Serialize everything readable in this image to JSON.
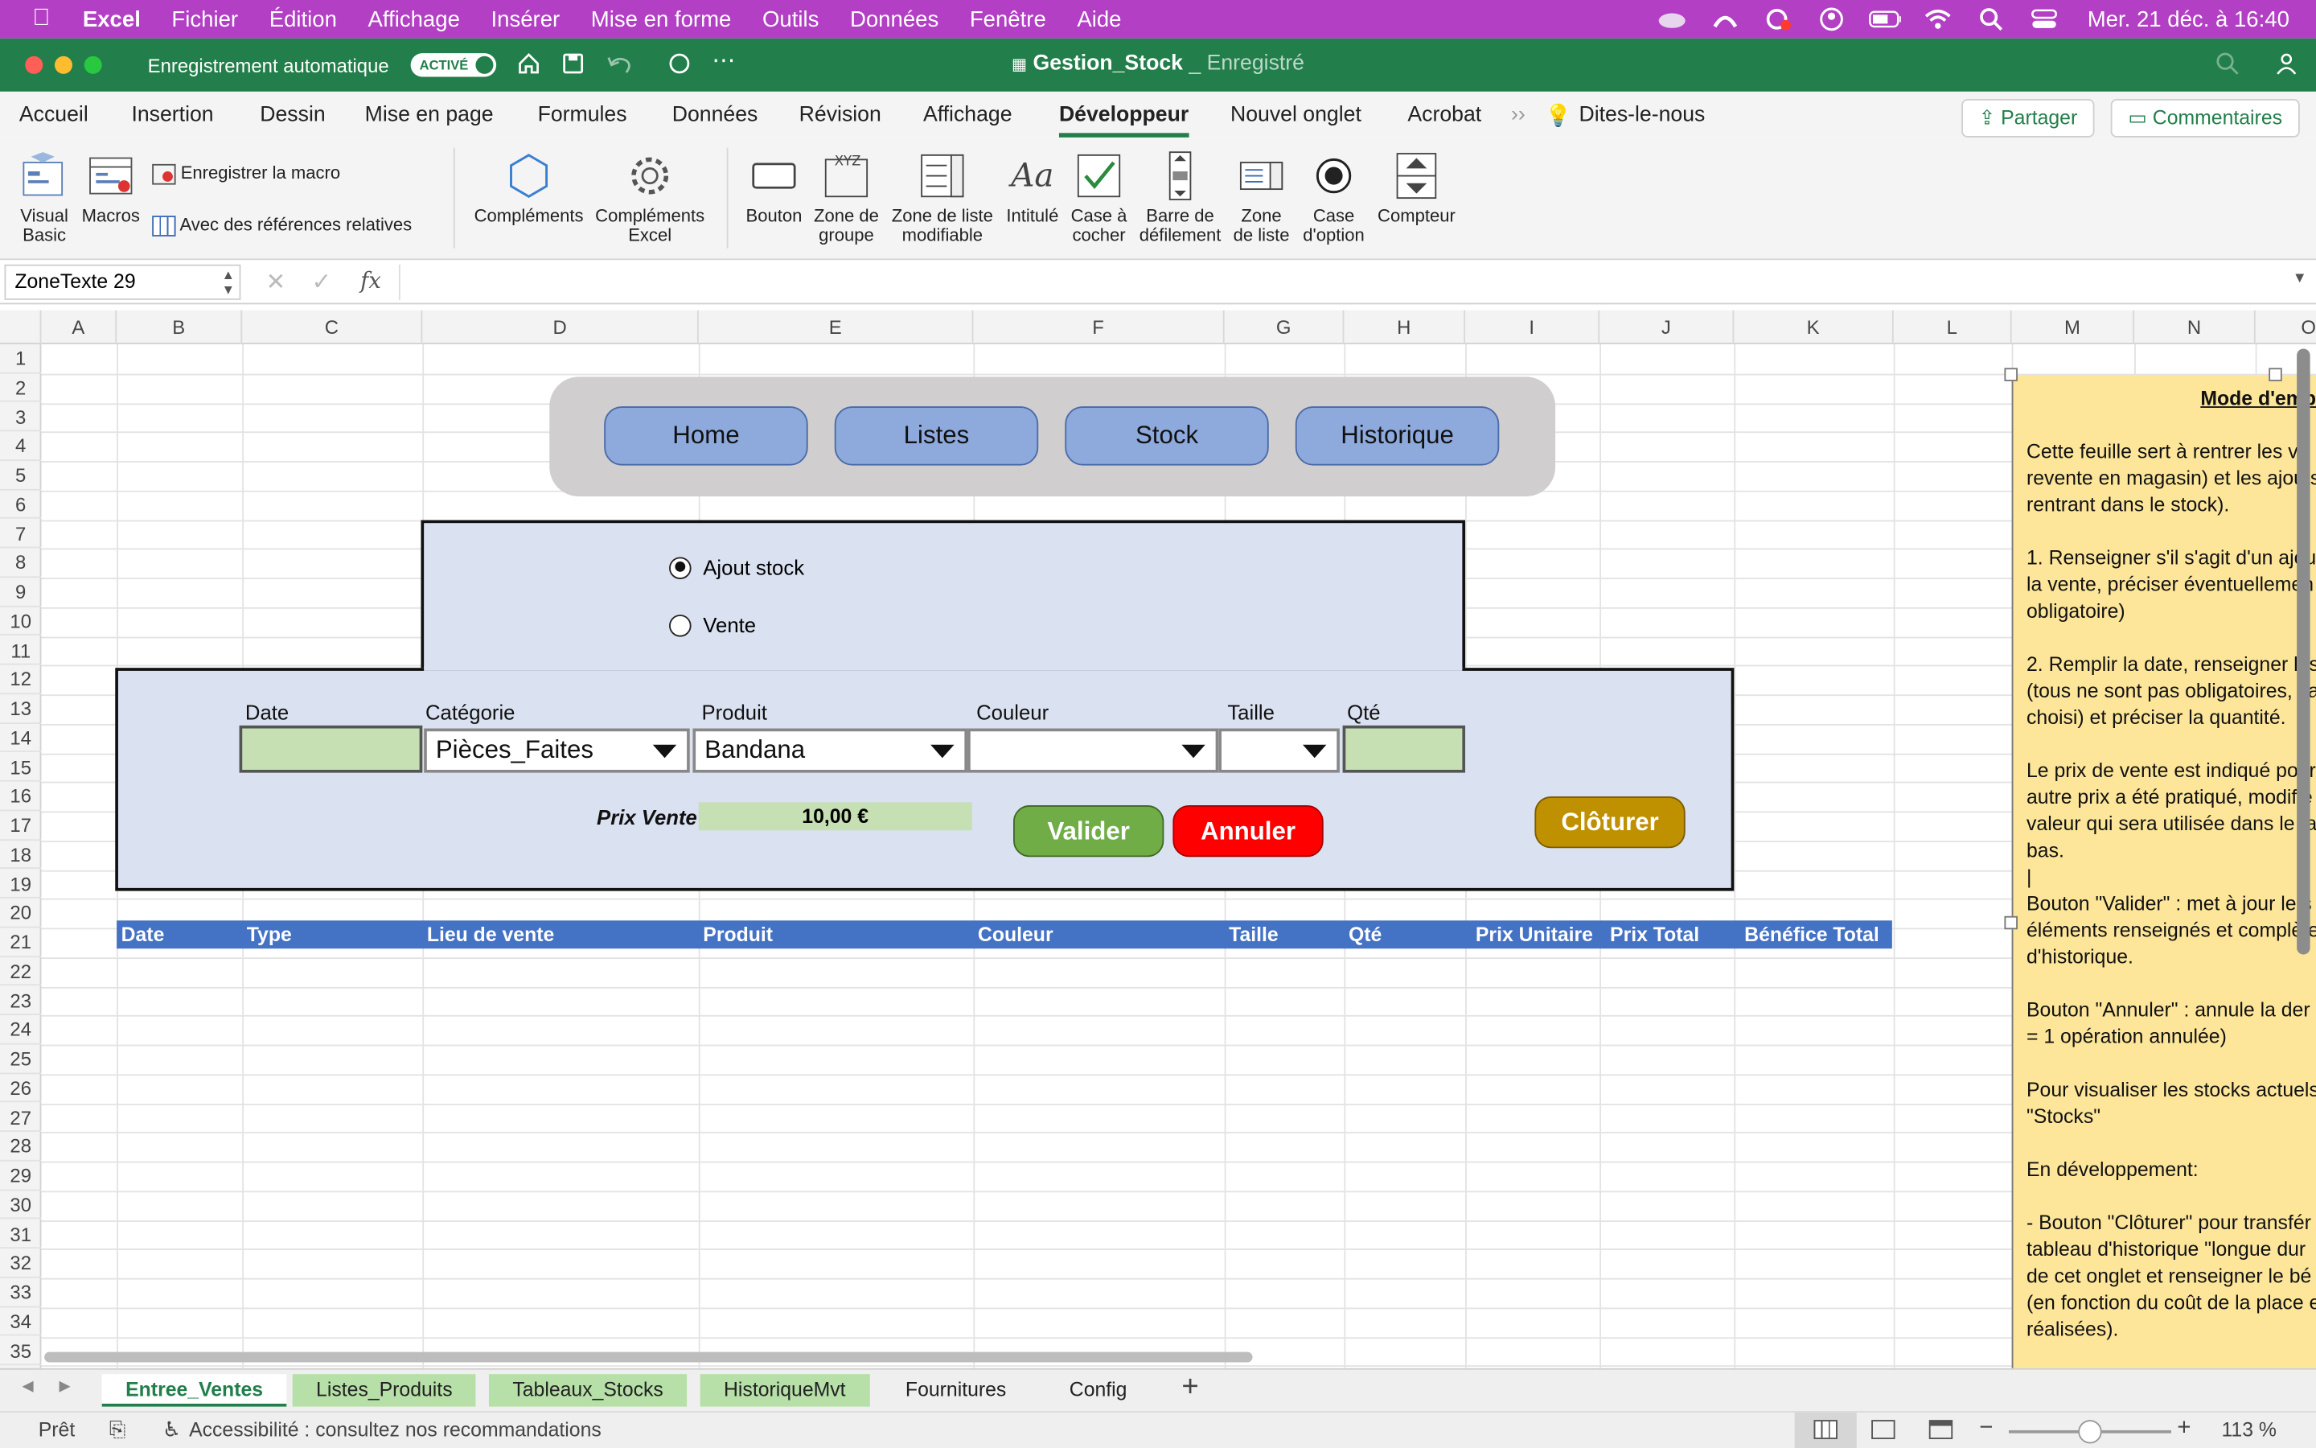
{
  "menubar": {
    "app": "Excel",
    "items": [
      "Fichier",
      "Édition",
      "Affichage",
      "Insérer",
      "Mise en forme",
      "Outils",
      "Données",
      "Fenêtre",
      "Aide"
    ],
    "datetime": "Mer. 21 déc. à 16:40"
  },
  "titlebar": {
    "autosave_label": "Enregistrement automatique",
    "autosave_state": "ACTIVÉ",
    "filename": "Gestion_Stock",
    "saved_status": "_ Enregistré"
  },
  "ribbon_tabs": [
    "Accueil",
    "Insertion",
    "Dessin",
    "Mise en page",
    "Formules",
    "Données",
    "Révision",
    "Affichage",
    "Développeur",
    "Nouvel onglet",
    "Acrobat"
  ],
  "ribbon_tabs_active": "Développeur",
  "tell_me": "Dites-le-nous",
  "share_label": "Partager",
  "comments_label": "Commentaires",
  "ribbon": {
    "visual_basic": "Visual Basic",
    "macros": "Macros",
    "record_macro": "Enregistrer la macro",
    "relative_refs": "Avec des références relatives",
    "addins": "Compléments",
    "excel_addins": "Compléments Excel",
    "button": "Bouton",
    "group_box": "Zone de groupe",
    "combo_box": "Zone de liste modifiable",
    "label": "Intitulé",
    "checkbox": "Case à cocher",
    "scrollbar": "Barre de défilement",
    "list_box": "Zone de liste",
    "option_button": "Case d'option",
    "spinner": "Compteur"
  },
  "formula_bar": {
    "name_box": "ZoneTexte 29",
    "fx": "fx",
    "value": ""
  },
  "columns": [
    "A",
    "B",
    "C",
    "D",
    "E",
    "F",
    "G",
    "H",
    "I",
    "J",
    "K",
    "L",
    "M",
    "N",
    "O"
  ],
  "rows": [
    "1",
    "2",
    "3",
    "4",
    "5",
    "6",
    "7",
    "8",
    "9",
    "10",
    "11",
    "12",
    "13",
    "14",
    "15",
    "16",
    "17",
    "18",
    "19",
    "20",
    "21",
    "22",
    "23",
    "24",
    "25",
    "26",
    "27",
    "28",
    "29",
    "30",
    "31",
    "32",
    "33",
    "34",
    "35"
  ],
  "nav_buttons": [
    "Home",
    "Listes",
    "Stock",
    "Historique"
  ],
  "mode_options": [
    {
      "label": "Ajout stock",
      "selected": true
    },
    {
      "label": "Vente",
      "selected": false
    }
  ],
  "form": {
    "labels": {
      "date": "Date",
      "category": "Catégorie",
      "product": "Produit",
      "color": "Couleur",
      "size": "Taille",
      "qty": "Qté"
    },
    "values": {
      "date": "",
      "category": "Pièces_Faites",
      "product": "Bandana",
      "color": "",
      "size": "",
      "qty": ""
    },
    "price_label": "Prix Vente",
    "price_value": "10,00 €",
    "validate": "Valider",
    "cancel": "Annuler",
    "close": "Clôturer"
  },
  "table_headers": [
    "Date",
    "Type",
    "Lieu de vente",
    "Produit",
    "Couleur",
    "Taille",
    "Qté",
    "Prix Unitaire",
    "Prix Total",
    "Bénéfice Total"
  ],
  "note": {
    "title": "Mode d'emp",
    "lines": [
      "",
      "Cette feuille sert à rentrer les ve",
      "revente en magasin) et les ajouts",
      "rentrant dans le stock).",
      "",
      "1. Renseigner s'il s'agit d'un ajou",
      "la vente, préciser éventuellemen",
      "obligatoire)",
      "",
      "2. Remplir la date, renseigner les",
      "(tous ne sont pas obligatoires, ça",
      "choisi) et préciser la quantité.",
      "",
      "Le prix de vente est indiqué pour",
      "autre prix a été pratiqué, modifie",
      "valeur qui sera utilisée dans le ta",
      "bas.",
      "|",
      "Bouton \"Valider\" : met à jour le s",
      "éléments renseignés et complète",
      "d'historique.",
      "",
      "Bouton \"Annuler\" : annule la der",
      "= 1 opération annulée)",
      "",
      "Pour visualiser les stocks actuels,",
      "\"Stocks\"",
      "",
      "En développement:",
      "",
      "- Bouton \"Clôturer\" pour transfér",
      "tableau d'historique \"longue dur",
      "de cet onglet et renseigner le bé",
      "(en fonction du coût de la place e",
      "réalisées)."
    ]
  },
  "sheet_tabs": [
    {
      "label": "Entree_Ventes",
      "color": "#b7e0a8",
      "active": true
    },
    {
      "label": "Listes_Produits",
      "color": "#b7e0a8",
      "active": false
    },
    {
      "label": "Tableaux_Stocks",
      "color": "#b7e0a8",
      "active": false
    },
    {
      "label": "HistoriqueMvt",
      "color": "#b7e0a8",
      "active": false
    },
    {
      "label": "Fournitures",
      "color": "",
      "active": false
    },
    {
      "label": "Config",
      "color": "",
      "active": false
    }
  ],
  "status": {
    "ready": "Prêt",
    "accessibility": "Accessibilité : consultez nos recommandations",
    "zoom": "113 %"
  },
  "colors": {
    "menubar": "#b23fc4",
    "excel_green": "#227e4a",
    "nav_button": "#8ea9dc",
    "panel": "#dae1f1",
    "input_green": "#c6e0b4",
    "header_blue": "#4472c4",
    "validate": "#70ad47",
    "cancel": "#ff0000",
    "close": "#bf9000",
    "note": "#fde69a"
  }
}
